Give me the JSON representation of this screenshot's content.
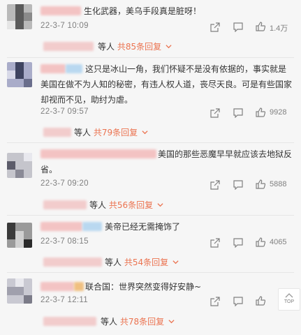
{
  "comments": [
    {
      "text": "生化武器，美乌手段真是脏呀！",
      "time": "22-3-7 10:09",
      "likes": "1.4万",
      "replies": {
        "suffix": "等人",
        "link": "共85条回复"
      }
    },
    {
      "text": "这只是冰山一角，我们怀疑不是没有依据的，事实就是美国在做不为人知的秘密，有违人权人道，丧尽天良。可是有些国家却视而不见，助纣为虐。",
      "time": "22-3-7 09:57",
      "likes": "9928",
      "replies": {
        "suffix": "等人",
        "link": "共79条回复"
      }
    },
    {
      "text": "美国的那些恶魔早早就应该去地狱反省。",
      "time": "22-3-7 09:20",
      "likes": "5888",
      "replies": {
        "suffix": "等人",
        "link": "共56条回复"
      }
    },
    {
      "text": "美帝已经无需掩饰了",
      "time": "22-3-7 08:15",
      "likes": "4065",
      "replies": {
        "suffix": "等人",
        "link": "共54条回复"
      }
    },
    {
      "text": "联合国：世界突然变得好安静~",
      "time": "22-3-7 12:11",
      "likes": "",
      "replies": {
        "suffix": "等人",
        "link": "共78条回复"
      }
    }
  ],
  "back_to_top": "TOP",
  "icons": [
    "share-icon",
    "comment-icon",
    "like-icon",
    "chevron-down-icon"
  ],
  "colors": {
    "link": "#eb7350",
    "meta": "#808080",
    "background": "#f6f6f6"
  }
}
